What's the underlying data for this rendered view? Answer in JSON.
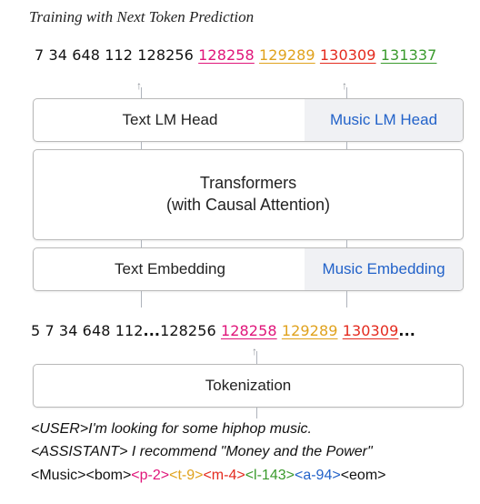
{
  "title": "Training with Next Token Prediction",
  "output_tokens": [
    {
      "text": "7",
      "color": "#111111",
      "underline": false
    },
    {
      "text": "34",
      "color": "#111111",
      "underline": false
    },
    {
      "text": "648",
      "color": "#111111",
      "underline": false
    },
    {
      "text": "112",
      "color": "#111111",
      "underline": false
    },
    {
      "text": "128256",
      "color": "#111111",
      "underline": false
    },
    {
      "text": "128258",
      "color": "#e0157a",
      "underline": true
    },
    {
      "text": "129289",
      "color": "#e0a21d",
      "underline": true
    },
    {
      "text": "130309",
      "color": "#e42a1e",
      "underline": true
    },
    {
      "text": "131337",
      "color": "#3a9a2c",
      "underline": true
    }
  ],
  "lm_head": {
    "text_label": "Text LM Head",
    "music_label": "Music LM Head"
  },
  "transformer": {
    "line1": "Transformers",
    "line2": "(with Causal Attention)"
  },
  "embedding": {
    "text_label": "Text Embedding",
    "music_label": "Music Embedding"
  },
  "input_tokens": [
    {
      "text": "5 7 34 648 112",
      "color": "#111111",
      "underline": false
    },
    {
      "text": "...",
      "color": "#111111",
      "underline": false,
      "bold": true
    },
    {
      "text": "128256",
      "color": "#111111",
      "underline": false
    },
    {
      "text": "128258",
      "color": "#e0157a",
      "underline": true
    },
    {
      "text": "129289",
      "color": "#e0a21d",
      "underline": true
    },
    {
      "text": "130309",
      "color": "#e42a1e",
      "underline": true
    },
    {
      "text": "...",
      "color": "#111111",
      "underline": false,
      "bold": true
    }
  ],
  "tokenization": {
    "label": "Tokenization"
  },
  "prompt": {
    "user_line": "<USER>I'm looking for some hiphop music.",
    "assistant_line": "<ASSISTANT> I recommend \"Money and the Power\"",
    "music_segments": [
      {
        "text": "<Music><bom>",
        "color": "#111111"
      },
      {
        "text": "<p-2>",
        "color": "#e0157a"
      },
      {
        "text": "<t-9>",
        "color": "#e0a21d"
      },
      {
        "text": "<m-4>",
        "color": "#e42a1e"
      },
      {
        "text": "<l-143>",
        "color": "#3a9a2c"
      },
      {
        "text": "<a-94>",
        "color": "#2262c9"
      },
      {
        "text": "<eom>",
        "color": "#111111"
      }
    ]
  }
}
